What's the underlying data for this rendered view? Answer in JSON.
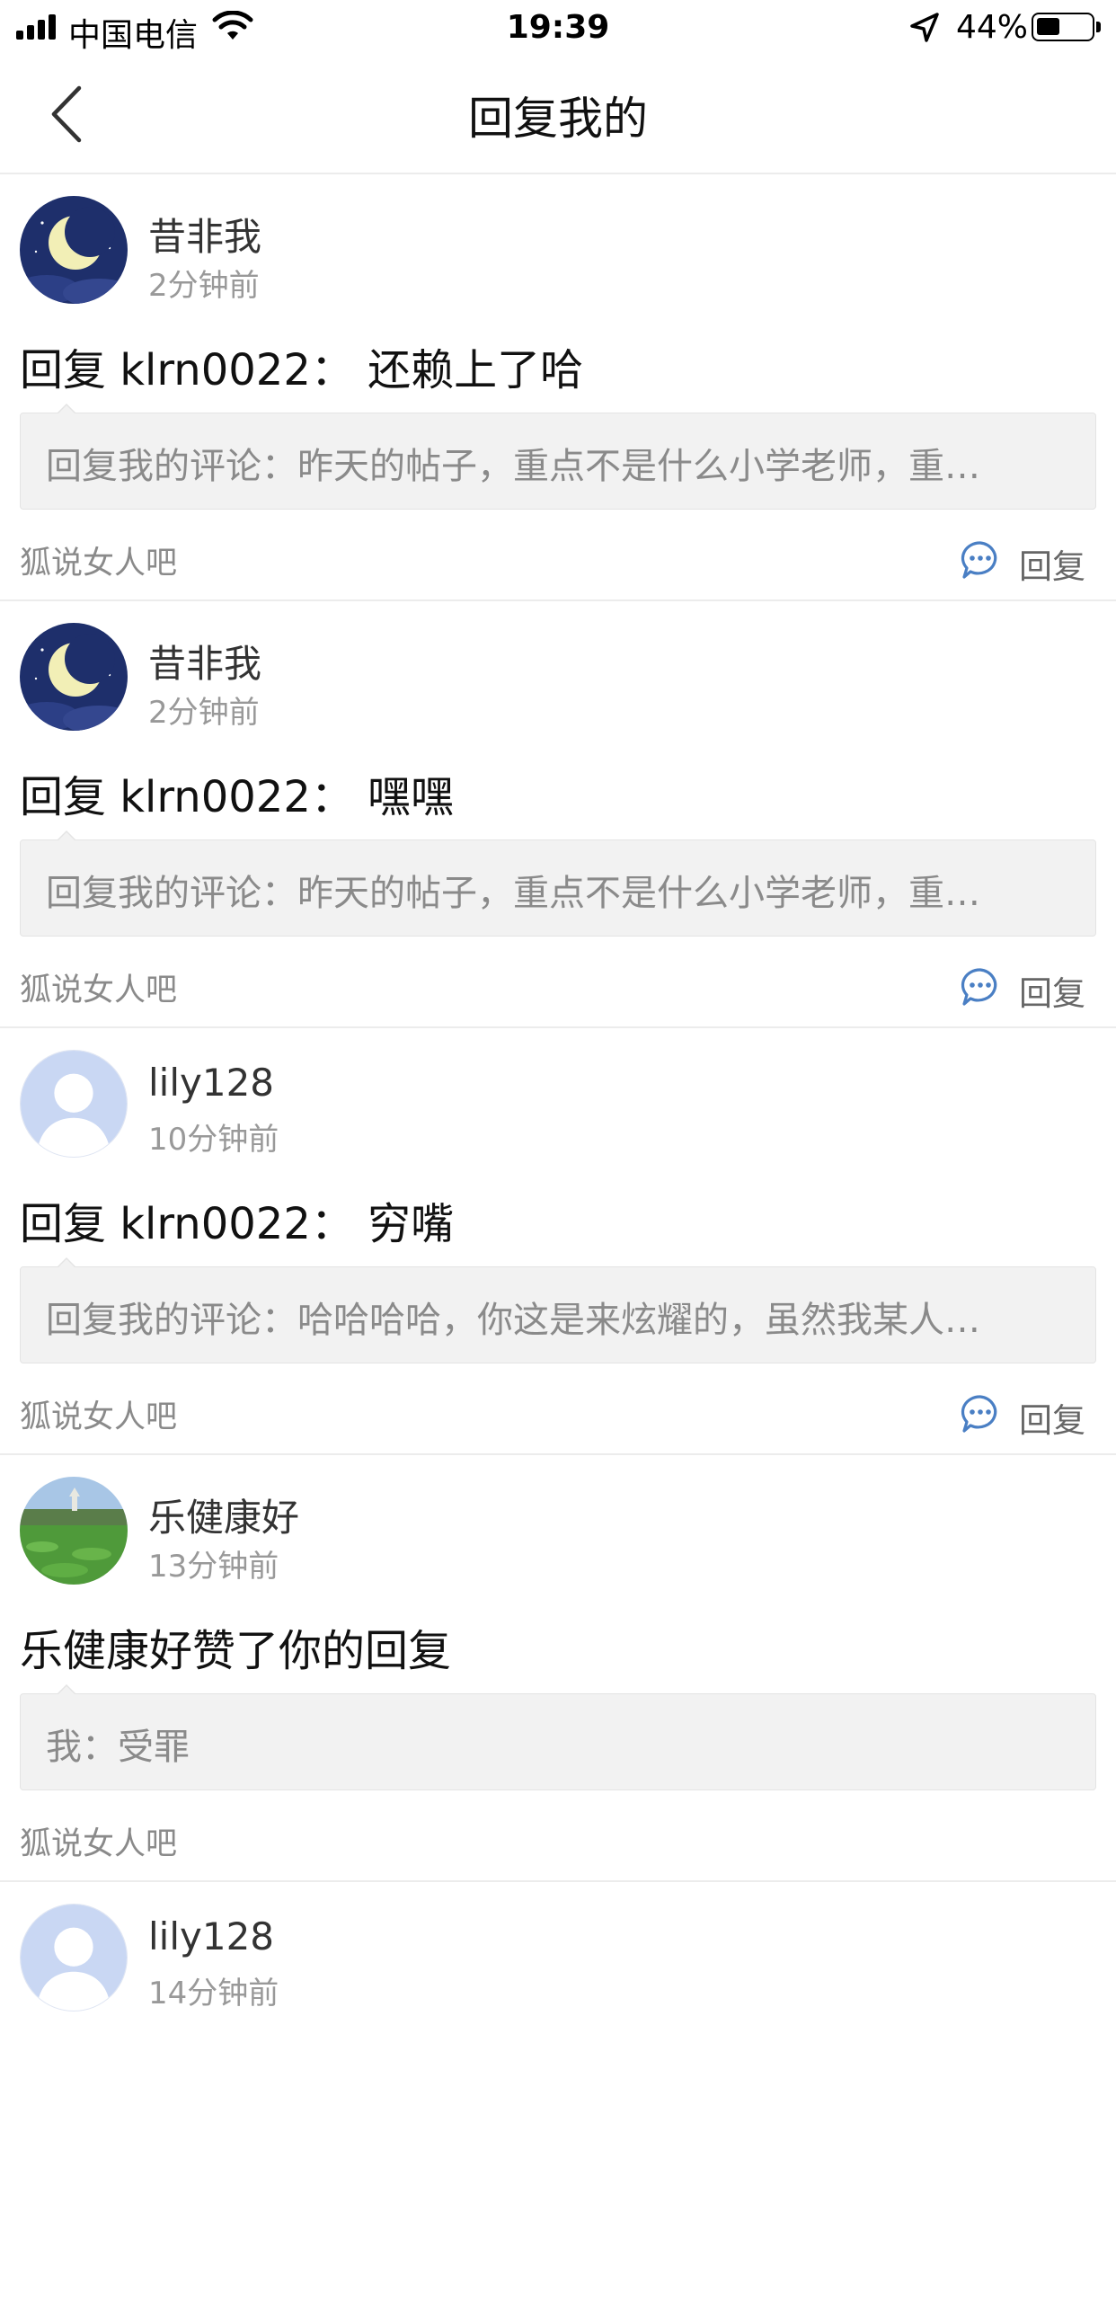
{
  "status_bar": {
    "carrier": "中国电信",
    "time": "19:39",
    "battery_percent": "44%",
    "battery_level": 0.44,
    "icons": [
      "signal-icon",
      "wifi-icon",
      "location-arrow-icon",
      "battery-icon"
    ]
  },
  "nav": {
    "title": "回复我的",
    "back_icon": "chevron-left-icon"
  },
  "feed": [
    {
      "username": "昔非我",
      "time": "2分钟前",
      "avatar": "moon-night-avatar",
      "reply": "回复 klrn0022： 还赖上了哈",
      "quote": "回复我的评论：昨天的帖子，重点不是什么小学老师，重…",
      "forum": "狐说女人吧",
      "action_label": "回复"
    },
    {
      "username": "昔非我",
      "time": "2分钟前",
      "avatar": "moon-night-avatar",
      "reply": "回复 klrn0022： 嘿嘿",
      "quote": "回复我的评论：昨天的帖子，重点不是什么小学老师，重…",
      "forum": "狐说女人吧",
      "action_label": "回复"
    },
    {
      "username": "lily128",
      "time": "10分钟前",
      "avatar": "default-person-avatar",
      "reply": "回复 klrn0022： 穷嘴",
      "quote": "回复我的评论：哈哈哈哈，你这是来炫耀的，虽然我某人…",
      "forum": "狐说女人吧",
      "action_label": "回复"
    },
    {
      "username": "乐健康好",
      "time": "13分钟前",
      "avatar": "landscape-avatar",
      "reply": "乐健康好赞了你的回复",
      "quote": "我：受罪",
      "forum": "狐说女人吧",
      "action_label": ""
    },
    {
      "username": "lily128",
      "time": "14分钟前",
      "avatar": "default-person-avatar"
    }
  ],
  "colors": {
    "divider": "#ececec",
    "quote_bg": "#f2f2f2",
    "secondary_text": "#999999",
    "comment_icon_blue": "#4a7fc4"
  }
}
